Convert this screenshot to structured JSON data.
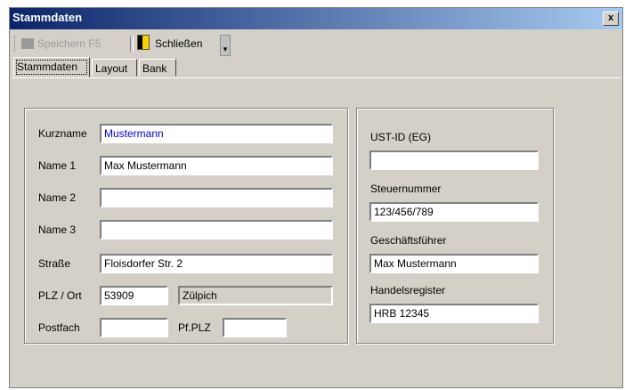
{
  "window": {
    "title": "Stammdaten",
    "close_glyph": "x"
  },
  "toolbar": {
    "save_label": "Speichern F5",
    "close_label": "Schließen",
    "save_icon": "floppy-disk-icon",
    "close_icon": "door-exit-icon"
  },
  "tabs": [
    {
      "label": "Stammdaten",
      "active": true
    },
    {
      "label": "Layout"
    },
    {
      "label": "Bank"
    }
  ],
  "left": {
    "kurzname": {
      "label": "Kurzname",
      "value": "Mustermann"
    },
    "name1": {
      "label": "Name 1",
      "value": "Max Mustermann"
    },
    "name2": {
      "label": "Name 2",
      "value": ""
    },
    "name3": {
      "label": "Name 3",
      "value": ""
    },
    "strasse": {
      "label": "Straße",
      "value": "Floisdorfer Str. 2"
    },
    "plz_ort": {
      "label": "PLZ / Ort",
      "plz": "53909",
      "ort": "Zülpich"
    },
    "postfach": {
      "label": "Postfach",
      "value": ""
    },
    "pf_plz": {
      "label": "Pf.PLZ",
      "value": ""
    }
  },
  "right": {
    "ustid": {
      "label": "UST-ID (EG)",
      "value": ""
    },
    "steuernummer": {
      "label": "Steuernummer",
      "value": "123/456/789"
    },
    "geschaeftsfuehrer": {
      "label": "Geschäftsführer",
      "value": "Max Mustermann"
    },
    "handelsregister": {
      "label": "Handelsregister",
      "value": "HRB 12345"
    }
  }
}
